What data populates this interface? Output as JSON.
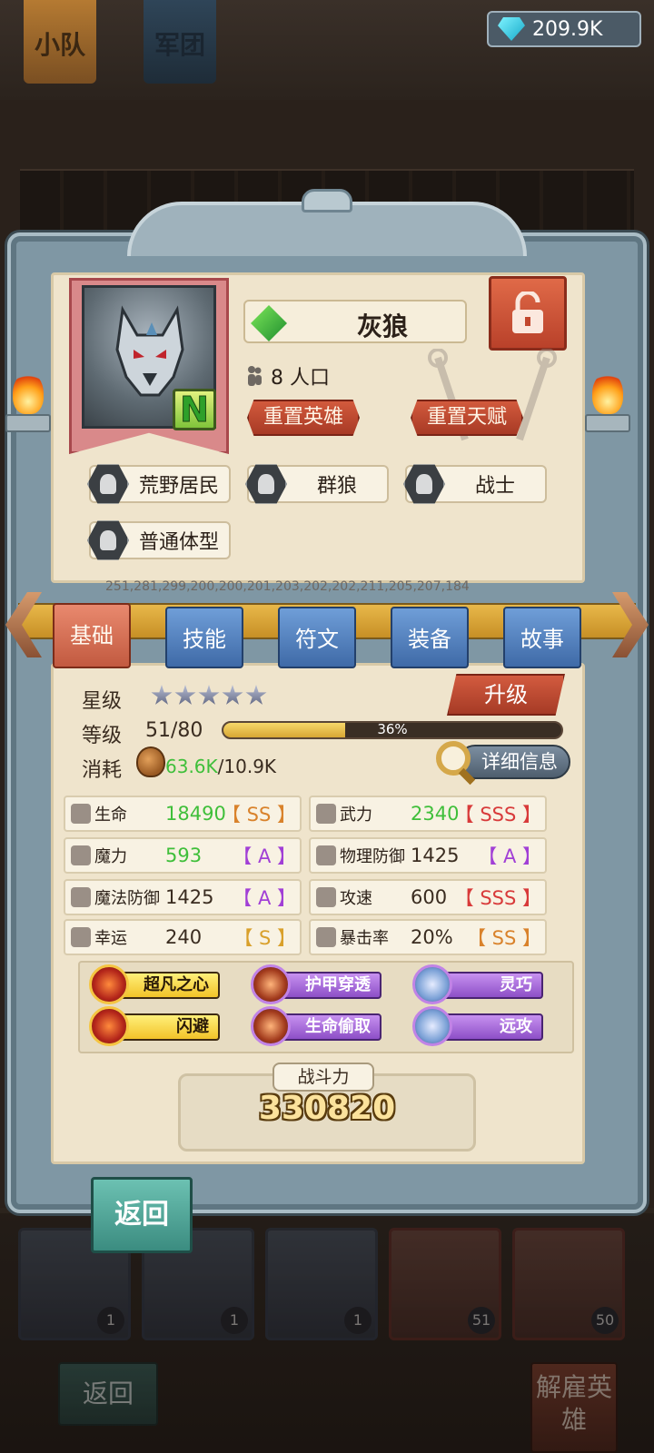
{
  "top_tabs": {
    "squad": "小队",
    "legion": "军团"
  },
  "currency": {
    "gem_amount": "209.9K",
    "icon": "diamond-icon"
  },
  "hero": {
    "name": "灰狼",
    "rarity": "N",
    "population": "8 人口",
    "reset_hero": "重置英雄",
    "reset_talent": "重置天赋",
    "lock_state": "unlocked"
  },
  "tags": [
    {
      "label": "荒野居民",
      "icon": "wilderness-icon"
    },
    {
      "label": "群狼",
      "icon": "wolf-icon"
    },
    {
      "label": "战士",
      "icon": "sword-shield-icon"
    },
    {
      "label": "普通体型",
      "icon": "body-type-icon"
    }
  ],
  "id_string": "251,281,299,200,200,201,203,202,202,211,205,207,184",
  "tabs": [
    {
      "label": "基础",
      "active": true
    },
    {
      "label": "技能",
      "active": false
    },
    {
      "label": "符文",
      "active": false
    },
    {
      "label": "装备",
      "active": false
    },
    {
      "label": "故事",
      "active": false
    }
  ],
  "basic": {
    "star_label": "星级",
    "stars": 5,
    "level_label": "等级",
    "level": "51/80",
    "level_progress": 0.36,
    "level_pct": "36%",
    "cost_label": "消耗",
    "cost_have": "63.6K",
    "cost_need": "/10.9K",
    "upgrade": "升级",
    "details": "详细信息"
  },
  "stats": [
    {
      "name": "生命",
      "value": "18490",
      "grade": "【 SS 】",
      "value_color": "#3fbf3a",
      "grade_color": "#d9822b"
    },
    {
      "name": "武力",
      "value": "2340",
      "grade": "【 SSS 】",
      "value_color": "#3fbf3a",
      "grade_color": "#d83a3a"
    },
    {
      "name": "魔力",
      "value": "593",
      "grade": "【 A 】",
      "value_color": "#3fbf3a",
      "grade_color": "#a13fd6"
    },
    {
      "name": "物理防御",
      "value": "1425",
      "grade": "【 A 】",
      "value_color": "#3a2c20",
      "grade_color": "#a13fd6"
    },
    {
      "name": "魔法防御",
      "value": "1425",
      "grade": "【 A 】",
      "value_color": "#3a2c20",
      "grade_color": "#a13fd6"
    },
    {
      "name": "攻速",
      "value": "600",
      "grade": "【 SSS 】",
      "value_color": "#3a2c20",
      "grade_color": "#d83a3a"
    },
    {
      "name": "幸运",
      "value": "240",
      "grade": "【 S 】",
      "value_color": "#3a2c20",
      "grade_color": "#d9a02b"
    },
    {
      "name": "暴击率",
      "value": "20%",
      "grade": "【 SS 】",
      "value_color": "#3a2c20",
      "grade_color": "#d9822b"
    }
  ],
  "traits": [
    {
      "label": "超凡之心",
      "style": "gold"
    },
    {
      "label": "护甲穿透",
      "style": "purple"
    },
    {
      "label": "灵巧",
      "style": "purple2"
    },
    {
      "label": "闪避",
      "style": "gold"
    },
    {
      "label": "生命偷取",
      "style": "purple"
    },
    {
      "label": "远攻",
      "style": "purple2"
    }
  ],
  "power": {
    "label": "战斗力",
    "value": "330820"
  },
  "back_label": "返回",
  "bottom": {
    "cards": [
      {
        "level": "1"
      },
      {
        "level": "1"
      },
      {
        "level": "1"
      },
      {
        "level": "51"
      },
      {
        "level": "50"
      }
    ],
    "back_label": "返回",
    "dismiss_label": "解雇英雄"
  },
  "colors": {
    "accent_red": "#c2472e",
    "tab_blue": "#4f7fbf",
    "panel_bg": "#efe4cc"
  }
}
